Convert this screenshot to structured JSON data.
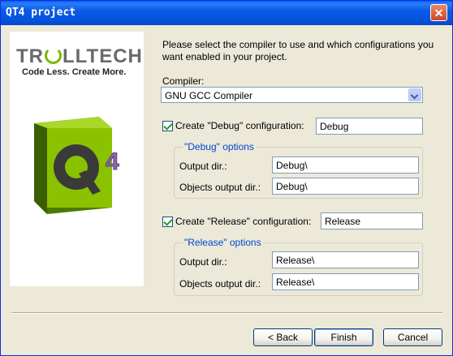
{
  "window": {
    "title": "QT4 project",
    "close_glyph": "✕"
  },
  "branding": {
    "logo_left": "TR",
    "logo_right": "LLTECH",
    "tagline": "Code Less. Create More.",
    "q4_letter": "Q",
    "q4_digit": "4"
  },
  "intro_text": "Please select the compiler to use and which configurations you want enabled in your project.",
  "compiler": {
    "label": "Compiler:",
    "selected": "GNU GCC Compiler"
  },
  "debug": {
    "checkbox_label": "Create \"Debug\" configuration:",
    "checked": true,
    "config_name": "Debug",
    "group_title": "\"Debug\" options",
    "output_dir_label": "Output dir.:",
    "output_dir": "Debug\\",
    "objects_dir_label": "Objects output dir.:",
    "objects_dir": "Debug\\"
  },
  "release": {
    "checkbox_label": "Create \"Release\" configuration:",
    "checked": true,
    "config_name": "Release",
    "group_title": "\"Release\" options",
    "output_dir_label": "Output dir.:",
    "output_dir": "Release\\",
    "objects_dir_label": "Objects output dir.:",
    "objects_dir": "Release\\"
  },
  "buttons": {
    "back": "< Back",
    "finish": "Finish",
    "cancel": "Cancel"
  }
}
